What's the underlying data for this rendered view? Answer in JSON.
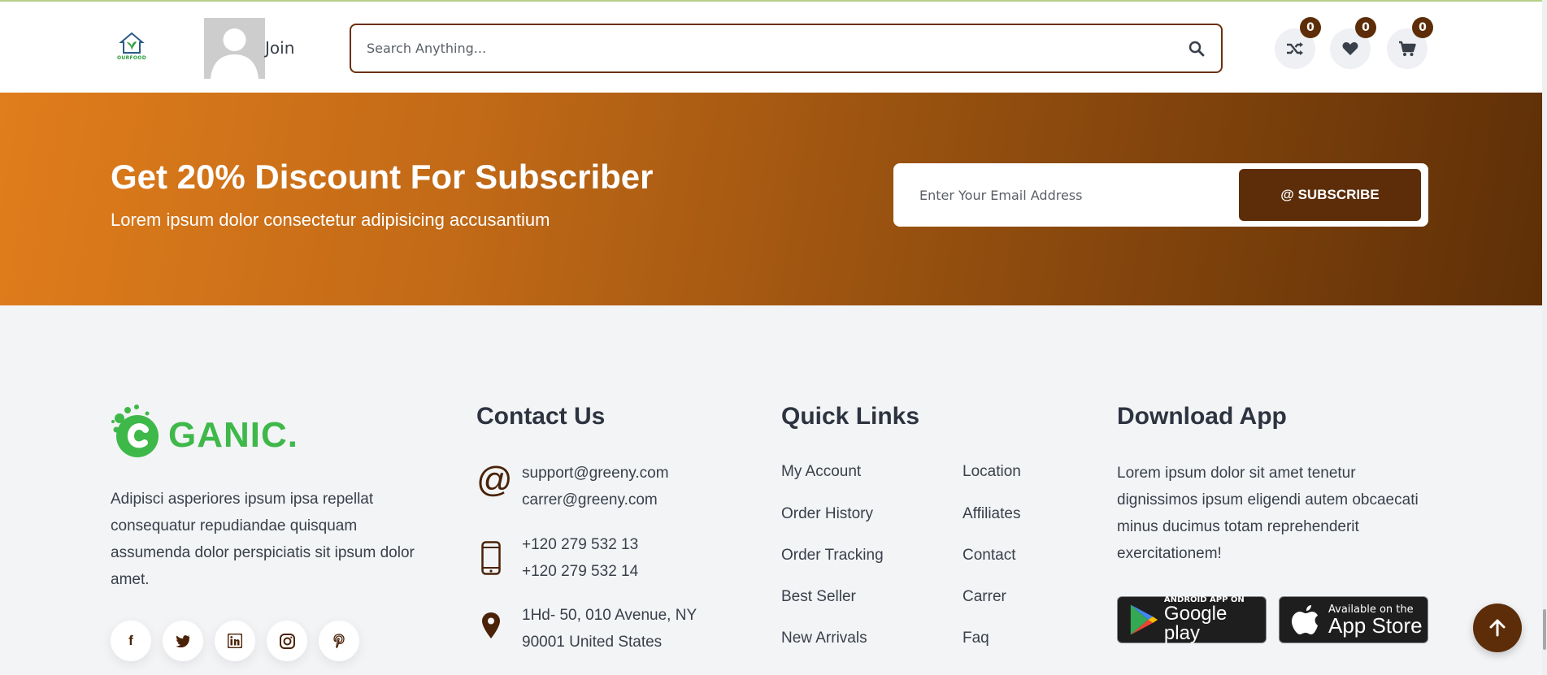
{
  "header": {
    "logo_text": "OURFOOD",
    "join_label": "Join",
    "search_placeholder": "Search Anything...",
    "compare_count": "0",
    "wishlist_count": "0",
    "cart_count": "0"
  },
  "subscribe": {
    "title": "Get 20% Discount For Subscriber",
    "subtitle": "Lorem ipsum dolor consectetur adipisicing accusantium",
    "email_placeholder": "Enter Your Email Address",
    "button_label": "@ SUBSCRIBE",
    "gradient_start": "#e07d1c",
    "gradient_end": "#5e2f07"
  },
  "footer": {
    "brand_text": "GANIC.",
    "about": "Adipisci asperiores ipsum ipsa repellat consequatur repudiandae quisquam assumenda dolor perspiciatis sit ipsum dolor amet.",
    "socials": [
      "f",
      "twitter",
      "linkedin",
      "instagram",
      "pinterest"
    ],
    "contact": {
      "title": "Contact Us",
      "email1": "support@greeny.com",
      "email2": "carrer@greeny.com",
      "phone1": "+120 279 532 13",
      "phone2": "+120 279 532 14",
      "address1": "1Hd- 50, 010 Avenue, NY",
      "address2": "90001 United States"
    },
    "quick_links": {
      "title": "Quick Links",
      "col1": [
        "My Account",
        "Order History",
        "Order Tracking",
        "Best Seller",
        "New Arrivals"
      ],
      "col2": [
        "Location",
        "Affiliates",
        "Contact",
        "Carrer",
        "Faq"
      ]
    },
    "download": {
      "title": "Download App",
      "text": "Lorem ipsum dolor sit amet tenetur dignissimos ipsum eligendi autem obcaecati minus ducimus totam reprehenderit exercitationem!",
      "google_small": "ANDROID APP ON",
      "google_big": "Google play",
      "apple_small": "Available on the",
      "apple_big": "App Store"
    }
  },
  "colors": {
    "accent": "#5c2d08",
    "brand_green": "#3fb84a",
    "background": "#f3f4f6"
  }
}
